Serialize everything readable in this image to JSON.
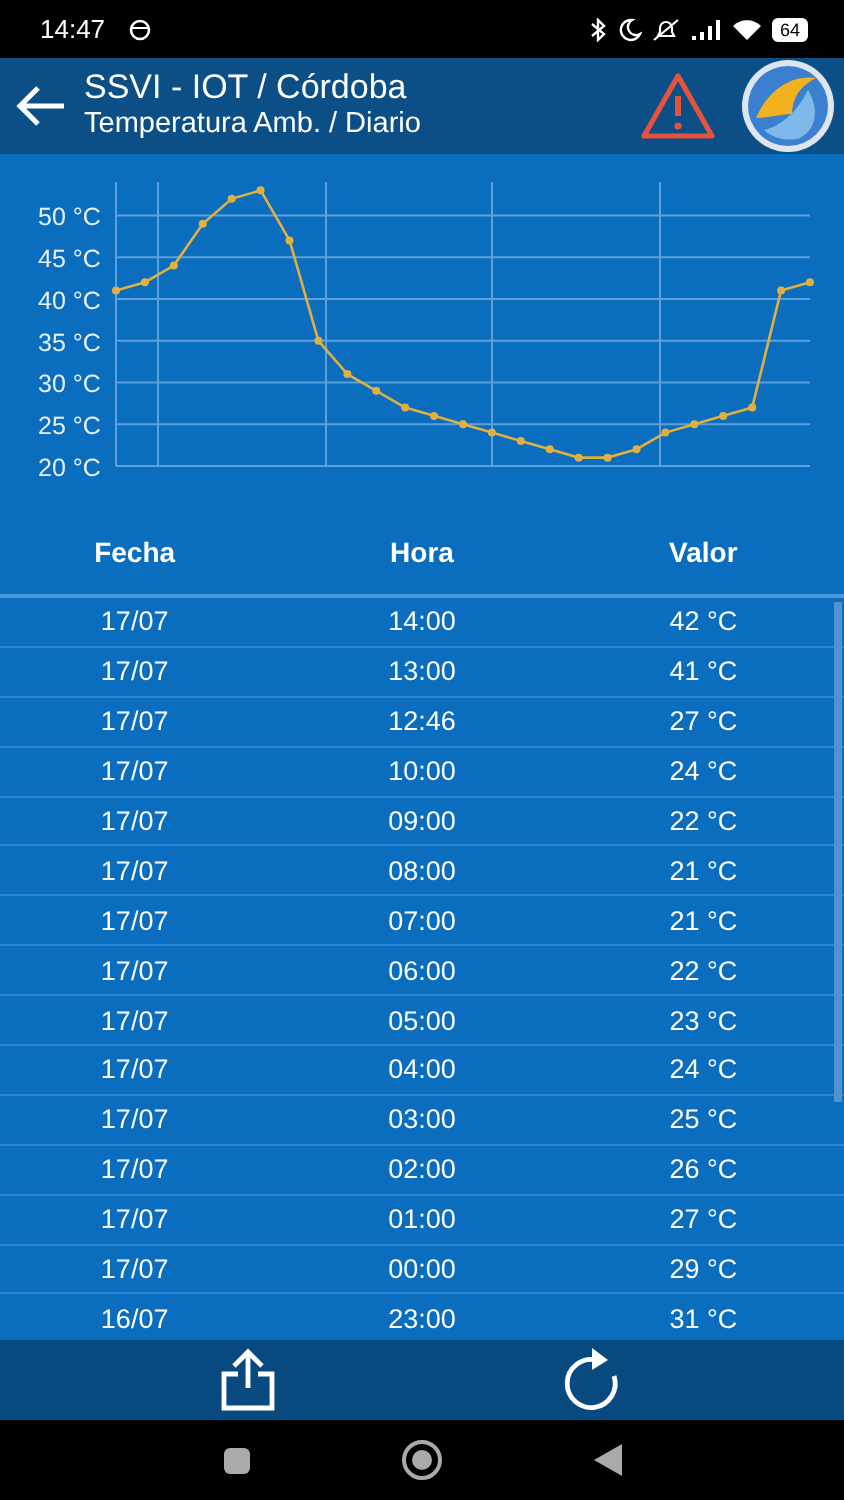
{
  "status_bar": {
    "time": "14:47",
    "battery": "64"
  },
  "header": {
    "title": "SSVI - IOT / Córdoba",
    "subtitle": "Temperatura Amb. / Diario"
  },
  "chart": {
    "chart_data": {
      "type": "line",
      "grid": true,
      "ylim": [
        20,
        54
      ],
      "yticks": [
        {
          "value": 20,
          "label": "20 °C"
        },
        {
          "value": 25,
          "label": "25 °C"
        },
        {
          "value": 30,
          "label": "30 °C"
        },
        {
          "value": 35,
          "label": "35 °C"
        },
        {
          "value": 40,
          "label": "40 °C"
        },
        {
          "value": 45,
          "label": "45 °C"
        },
        {
          "value": 50,
          "label": "50 °C"
        }
      ],
      "series": [
        {
          "color": "#e0b040",
          "marker": true,
          "values": [
            41,
            42,
            44,
            49,
            52,
            53,
            47,
            35,
            31,
            29,
            27,
            26,
            25,
            24,
            23,
            22,
            21,
            21,
            22,
            24,
            25,
            26,
            27,
            41,
            42
          ]
        }
      ]
    }
  },
  "table": {
    "columns": [
      "Fecha",
      "Hora",
      "Valor"
    ],
    "rows": [
      [
        "17/07",
        "14:00",
        "42 °C"
      ],
      [
        "17/07",
        "13:00",
        "41 °C"
      ],
      [
        "17/07",
        "12:46",
        "27 °C"
      ],
      [
        "17/07",
        "10:00",
        "24 °C"
      ],
      [
        "17/07",
        "09:00",
        "22 °C"
      ],
      [
        "17/07",
        "08:00",
        "21 °C"
      ],
      [
        "17/07",
        "07:00",
        "21 °C"
      ],
      [
        "17/07",
        "06:00",
        "22 °C"
      ],
      [
        "17/07",
        "05:00",
        "23 °C"
      ],
      [
        "17/07",
        "04:00",
        "24 °C"
      ],
      [
        "17/07",
        "03:00",
        "25 °C"
      ],
      [
        "17/07",
        "02:00",
        "26 °C"
      ],
      [
        "17/07",
        "01:00",
        "27 °C"
      ],
      [
        "17/07",
        "00:00",
        "29 °C"
      ],
      [
        "16/07",
        "23:00",
        "31 °C"
      ]
    ]
  }
}
